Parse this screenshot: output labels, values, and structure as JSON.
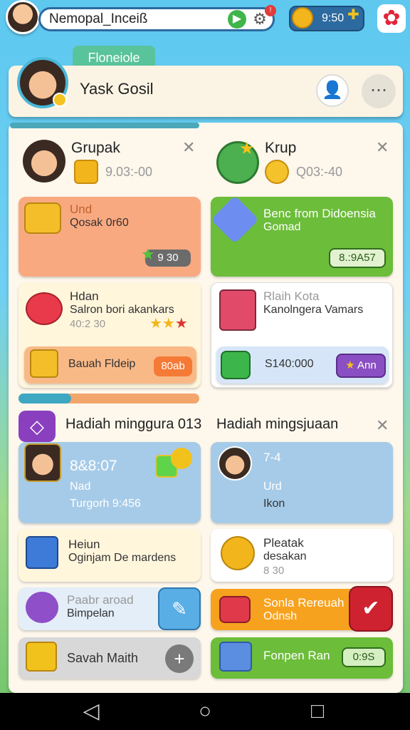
{
  "topbar": {
    "player_name": "Nemopal_Inceiß",
    "coins": "9:50",
    "badge": "!"
  },
  "profile": {
    "tab_label": "Floneiole",
    "name": "Yask Gosil"
  },
  "section_left": {
    "title": "Grupak",
    "amount": "9.03:-00",
    "card_promo": {
      "title": "Und",
      "subtitle": "Qosak 0r60",
      "price": "9 30"
    },
    "card_gift": {
      "title": "Hdan",
      "subtitle": "Salron bori akankars",
      "meta": "40:2 30"
    },
    "card_action": {
      "label": "Bauah Fldeip",
      "button": "80ab"
    }
  },
  "section_right": {
    "title": "Krup",
    "amount": "Q03:-40",
    "card_promo": {
      "title": "Benc from Didoensia",
      "subtitle": "Gomad",
      "price": "8.:9A57"
    },
    "card_gift": {
      "title": "Rlaih Kota",
      "subtitle": "Kanolngera Vamars"
    },
    "card_action": {
      "label": "S140:000",
      "button": "Ann"
    }
  },
  "weekly_left": {
    "title": "Hadiah minggura 013",
    "timer": "8&8:07",
    "line1": "Nad",
    "line2": "Turgorh 9:456",
    "card2": {
      "title": "Heiun",
      "subtitle": "Oginjam De mardens"
    },
    "card3": {
      "title": "Paabr aroad",
      "subtitle": "Bimpelan"
    },
    "card4": {
      "title": "Savah Maith"
    }
  },
  "weekly_right": {
    "title": "Hadiah mingsjuaan",
    "line1": "7-4",
    "line2": "Urd",
    "line3": "Ikon",
    "card2": {
      "title": "Pleatak",
      "subtitle": "desakan",
      "meta": "8 30"
    },
    "card3": {
      "title": "Sonla Rereuah",
      "subtitle": "Odnsh"
    },
    "card4": {
      "title": "Fonpen Ran",
      "value": "0:9S"
    }
  },
  "colors": {
    "accent_blue": "#2c6aa0",
    "orange_card": "#f9a980",
    "green_card": "#6cbd3a",
    "blue_card": "#a6cbe8",
    "settings_red": "#e0263a"
  },
  "icons": [
    "gear-icon",
    "coin-icon",
    "plus-icon",
    "user-icon",
    "options-icon",
    "close-icon",
    "star-icon",
    "check-icon",
    "back-icon",
    "home-icon",
    "recents-icon"
  ]
}
